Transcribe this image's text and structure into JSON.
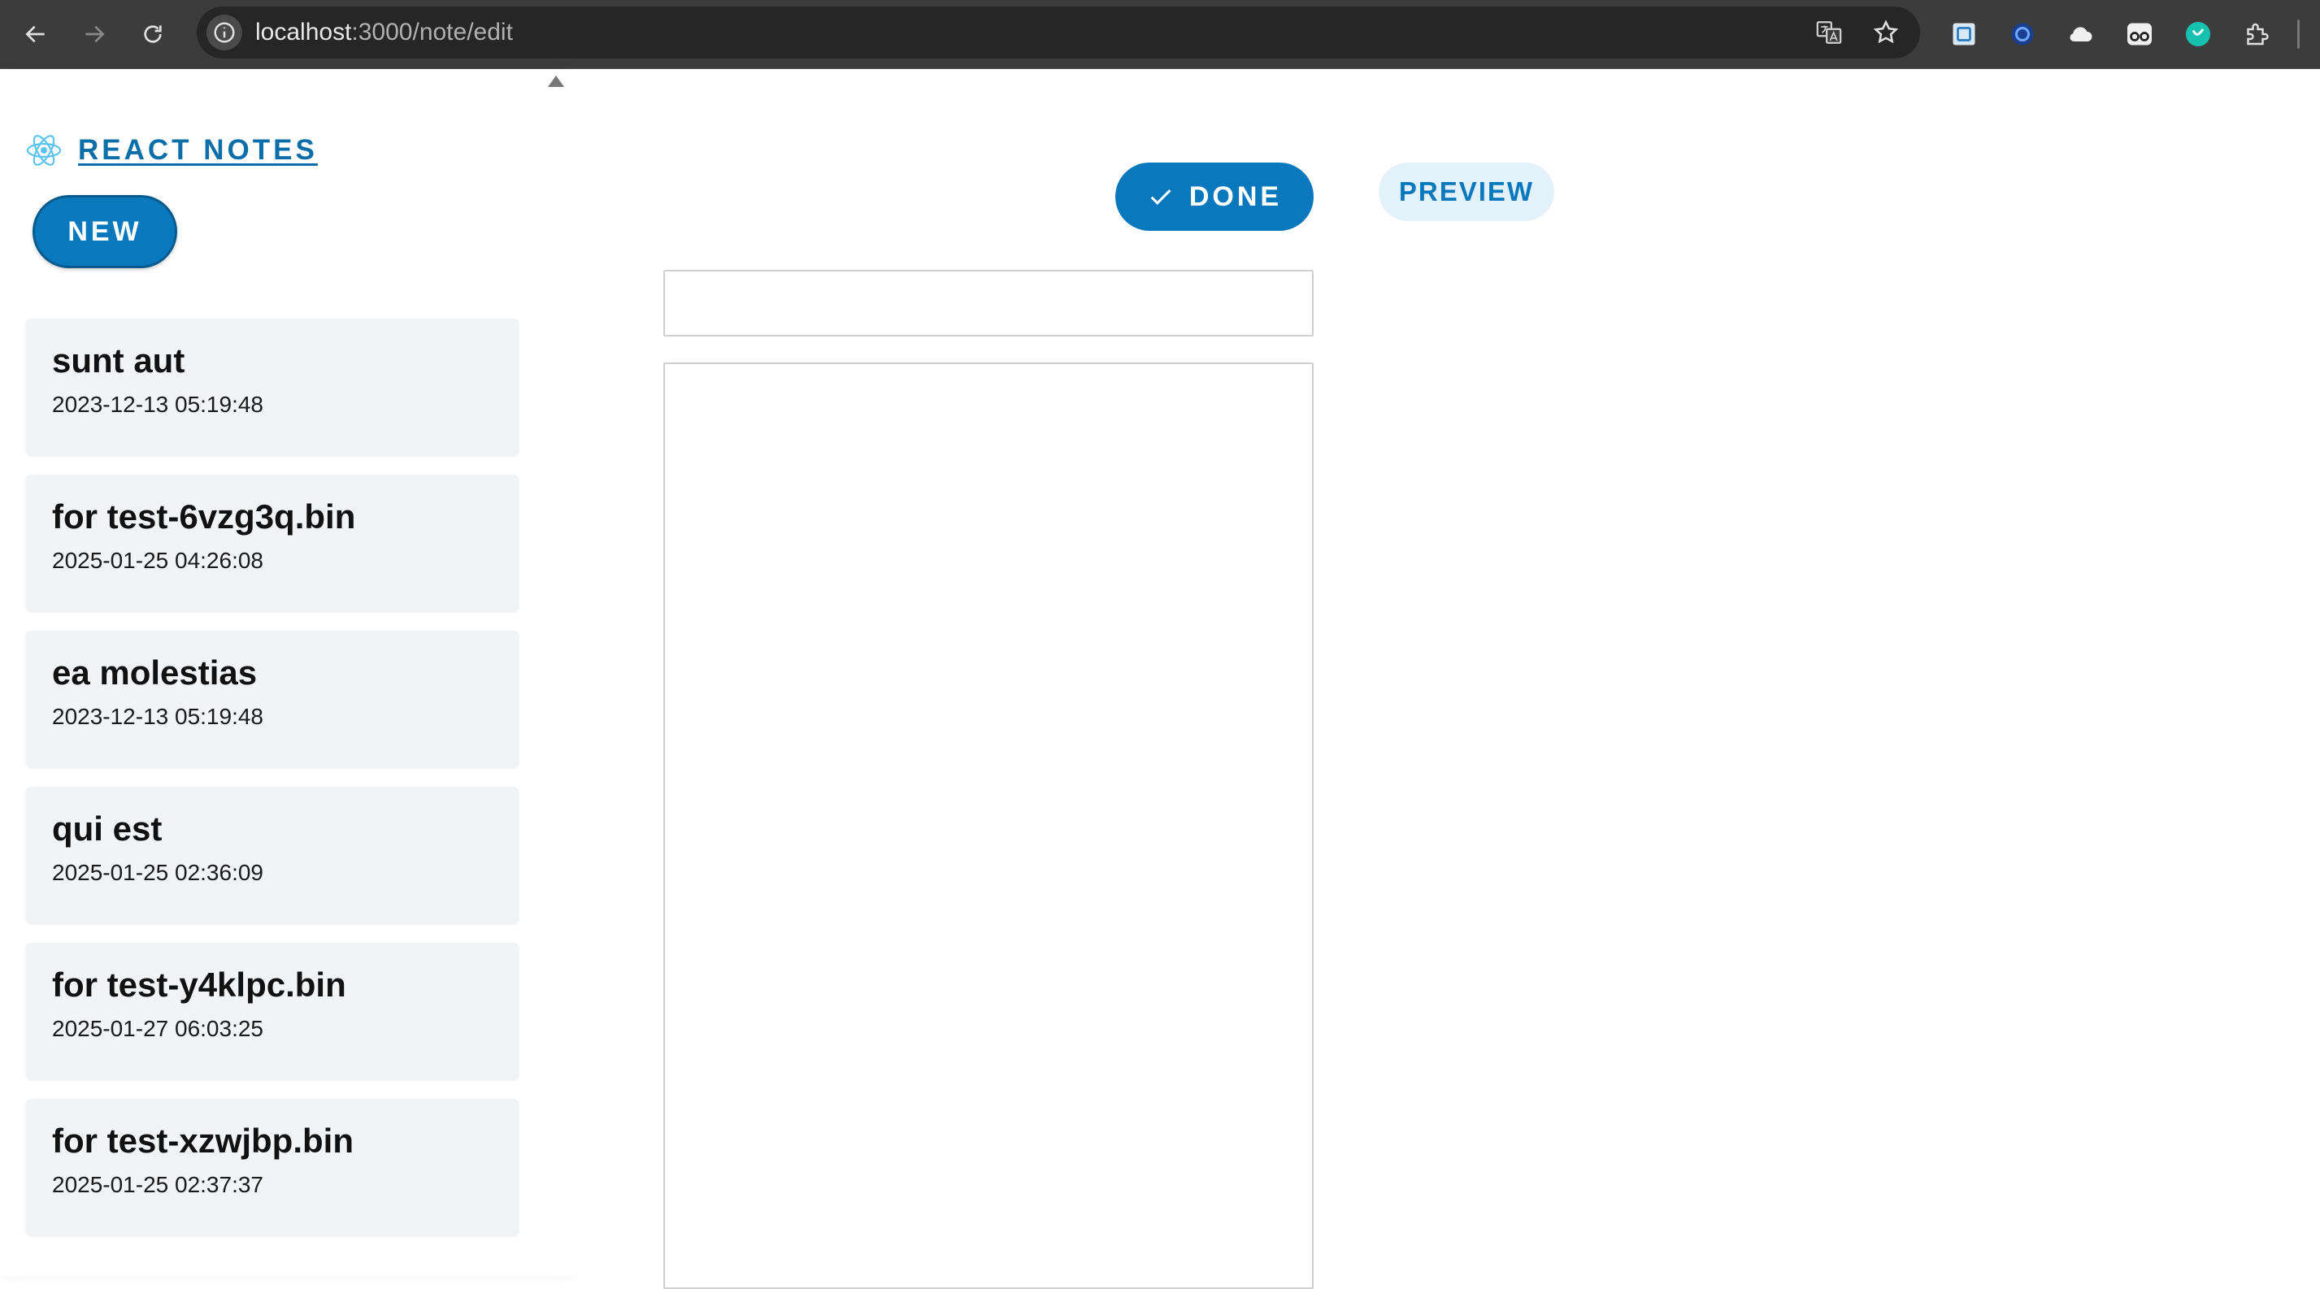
{
  "browser": {
    "url_host": "localhost",
    "url_rest": ":3000/note/edit"
  },
  "sidebar": {
    "brand": "REACT NOTES",
    "new_button": "NEW",
    "notes": [
      {
        "title": "sunt aut",
        "date": "2023-12-13 05:19:48"
      },
      {
        "title": "for test-6vzg3q.bin",
        "date": "2025-01-25 04:26:08"
      },
      {
        "title": "ea molestias",
        "date": "2023-12-13 05:19:48"
      },
      {
        "title": "qui est",
        "date": "2025-01-25 02:36:09"
      },
      {
        "title": "for test-y4klpc.bin",
        "date": "2025-01-27 06:03:25"
      },
      {
        "title": "for test-xzwjbp.bin",
        "date": "2025-01-25 02:37:37"
      }
    ]
  },
  "editor": {
    "done_button": "DONE",
    "preview_button": "PREVIEW",
    "title_value": "",
    "body_value": ""
  },
  "colors": {
    "accent": "#0a78bd",
    "chrome_bg": "#3c3c3c",
    "note_card_bg": "#f2f3f4"
  }
}
